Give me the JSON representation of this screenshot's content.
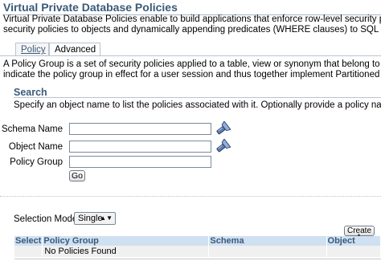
{
  "header": {
    "title": "Virtual Private Database Policies",
    "intro_line1": "Virtual Private Database Policies enable to build applications that enforce row-level security policies at the object",
    "intro_line2": "security policies to objects and dynamically appending predicates (WHERE clauses) to SQL statements that query"
  },
  "tabs": [
    {
      "label": "Policy",
      "selected": false
    },
    {
      "label": "Advanced",
      "selected": true
    }
  ],
  "description": {
    "line1": "A Policy Group is a set of security policies applied to a table, view or synonym that belong to an application. Appl",
    "line2": "indicate the policy group in effect for a user session and thus together implement Partitioned Fine Grained Access"
  },
  "search": {
    "heading": "Search",
    "hint": "Specify an object name to list the policies associated with it. Optionally provide a policy name to filter the data.",
    "fields": [
      {
        "label": "Schema Name",
        "value": ""
      },
      {
        "label": "Object Name",
        "value": ""
      },
      {
        "label": "Policy Group",
        "value": ""
      }
    ],
    "go_label": "Go",
    "lookup_icon": "flashlight-icon"
  },
  "results": {
    "selection_mode_label": "Selection Mode",
    "selection_mode_value": "Single",
    "create_label": "Create",
    "columns": [
      "Select",
      "Policy Group",
      "Schema",
      "Object"
    ],
    "empty_message": "No Policies Found"
  },
  "colors": {
    "heading_blue": "#3a5a7a",
    "table_header_bg": "#cfe0f1",
    "rule": "#b9c4d0"
  }
}
